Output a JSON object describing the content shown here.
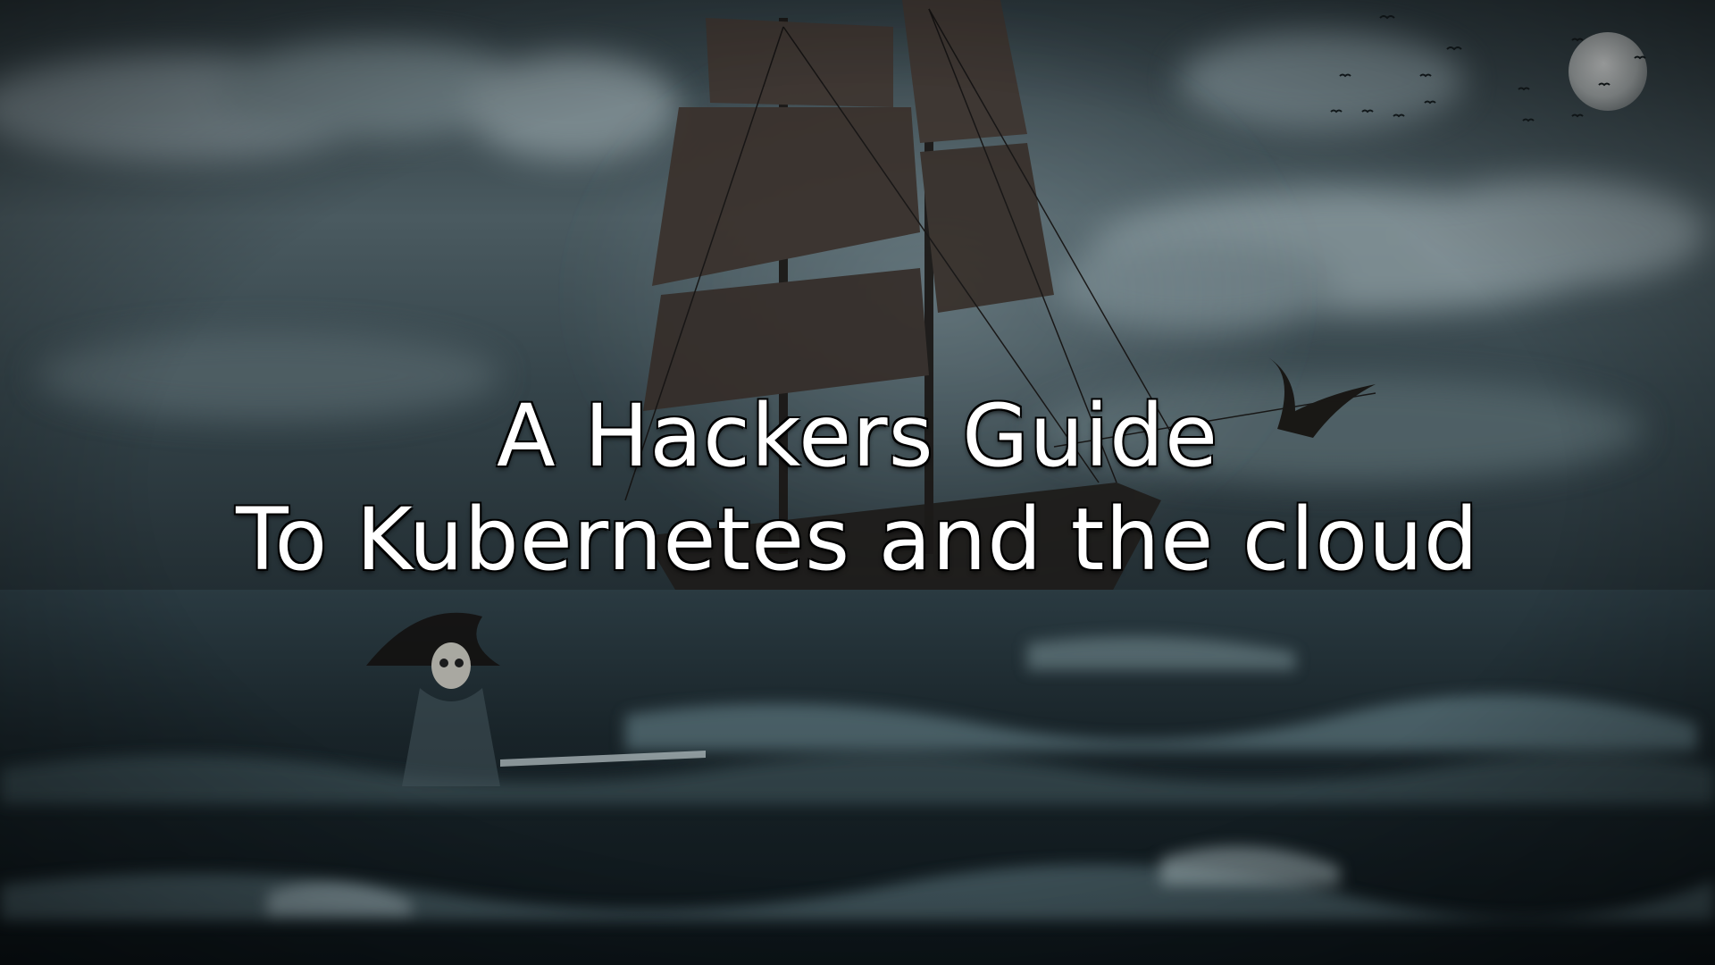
{
  "slide": {
    "title_line_1": "A Hackers Guide",
    "title_line_2": "To Kubernetes and the cloud"
  },
  "background": {
    "scene": "stormy-sea-pirate-ship",
    "colors": {
      "sky_top": "#3a474c",
      "sky_mid": "#54656b",
      "sea_dark": "#0f1a1f",
      "sea_foam": "#9fb6bd",
      "moon": "#c9cdcd",
      "title_text": "#ffffff"
    }
  }
}
